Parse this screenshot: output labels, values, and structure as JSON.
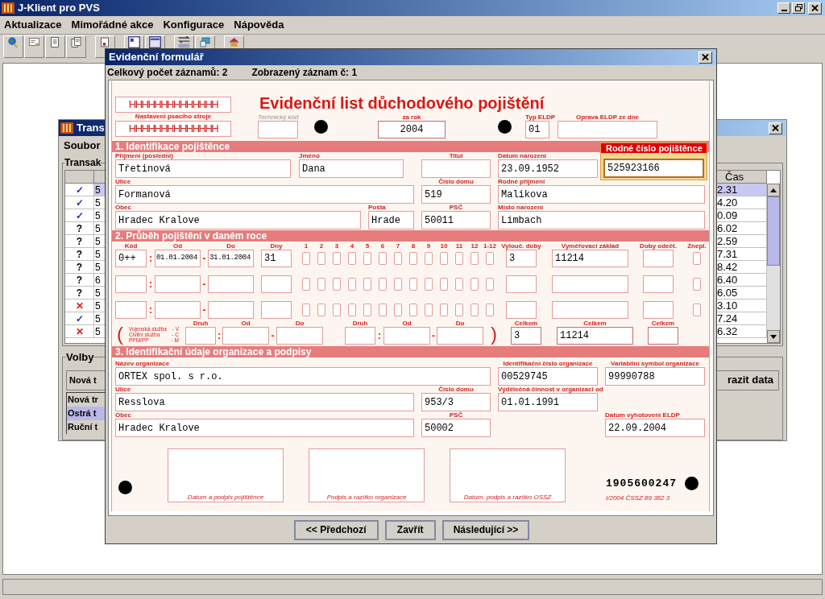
{
  "app": {
    "title": "J-Klient pro PVS",
    "menu": [
      "Aktualizace",
      "Mimořádné akce",
      "Konfigurace",
      "Nápověda"
    ]
  },
  "transactions_window": {
    "title": "Trans",
    "menu": [
      "Soubor"
    ],
    "table_group": "Transak",
    "time_header": "Čas",
    "rows": [
      {
        "kind": "ok",
        "mark": "✓",
        "column_2": "5",
        "time": "2.31",
        "selected": true
      },
      {
        "kind": "ok",
        "mark": "✓",
        "column_2": "5",
        "time": "4.20",
        "selected": false
      },
      {
        "kind": "ok",
        "mark": "✓",
        "column_2": "5",
        "time": "0.09",
        "selected": false
      },
      {
        "kind": "pending",
        "mark": "?",
        "column_2": "5",
        "time": "6.02",
        "selected": false
      },
      {
        "kind": "pending",
        "mark": "?",
        "column_2": "5",
        "time": "2.59",
        "selected": false
      },
      {
        "kind": "pending",
        "mark": "?",
        "column_2": "5",
        "time": "7.31",
        "selected": false
      },
      {
        "kind": "pending",
        "mark": "?",
        "column_2": "5",
        "time": "8.42",
        "selected": false
      },
      {
        "kind": "pending",
        "mark": "?",
        "column_2": "6",
        "time": "6.40",
        "selected": false
      },
      {
        "kind": "pending",
        "mark": "?",
        "column_2": "5",
        "time": "6.05",
        "selected": false
      },
      {
        "kind": "error",
        "mark": "✕",
        "column_2": "5",
        "time": "3.10",
        "selected": false
      },
      {
        "kind": "ok",
        "mark": "✓",
        "column_2": "5",
        "time": "7.24",
        "selected": false
      },
      {
        "kind": "error",
        "mark": "✕",
        "column_2": "5",
        "time": "6.32",
        "selected": false
      }
    ],
    "options_group": "Volby",
    "new_button": "Nová t",
    "modes": [
      {
        "label": "Nová tr",
        "selected": false
      },
      {
        "label": "Ostrá t",
        "selected": true
      },
      {
        "label": "Ruční t",
        "selected": false
      }
    ],
    "show_button": "razit data"
  },
  "dialog": {
    "title": "Evidenční formulář",
    "record_count": "Celkový počet záznamů: 2",
    "current_record": "Zobrazený záznam č: 1",
    "form": {
      "header": {
        "typewriter_label": "Nastavení psacího stroje",
        "typewriter_test": [
          "HHHHHHHHHHHHHH",
          "HHHHHHHHHHHHHH"
        ],
        "title": "Evidenční list důchodového pojištění",
        "technical_code": {
          "label": "Technický kód"
        },
        "year": {
          "label": "za rok",
          "value": "2004"
        },
        "eldp_type": {
          "label": "Typ ELDP",
          "value": "01"
        },
        "correction_date": {
          "label": "Oprava ELDP ze dne"
        }
      },
      "section_1": {
        "title": "1. Identifikace pojištěnce",
        "birth_number": {
          "label": "Rodné číslo pojištěnce",
          "value": "525923166"
        },
        "rows": [
          {
            "surname": {
              "label": "Příjmení (poslední)",
              "value": "Třetinová"
            },
            "first_name": {
              "label": "Jméno",
              "value": "Dana"
            },
            "degree": {
              "label": "Titul"
            },
            "birth_date": {
              "label": "Datum narození",
              "value": "23.09.1952"
            }
          },
          {
            "street": {
              "label": "Ulice",
              "value": "Formanová"
            },
            "house_number": {
              "label": "Číslo domu",
              "value": "519"
            },
            "birth_surname": {
              "label": "Rodné příjmení",
              "value": "Malikova"
            }
          },
          {
            "town": {
              "label": "Obec",
              "value": "Hradec Kralove"
            },
            "post_office": {
              "label": "Pošta",
              "value": "Hrade"
            },
            "postcode": {
              "label": "PSČ",
              "value": "50011"
            },
            "birth_place": {
              "label": "Místo narození",
              "value": "Limbach"
            }
          }
        ]
      },
      "section_2": {
        "title": "2. Průběh pojištění v daném roce",
        "headers": [
          "Kód",
          "Od",
          "Do",
          "Dny"
        ],
        "months": [
          "1",
          "2",
          "3",
          "4",
          "5",
          "6",
          "7",
          "8",
          "9",
          "10",
          "11",
          "12",
          "1-12"
        ],
        "right_headers": [
          "Vylouč. doby",
          "Vyměřovací základ",
          "Doby odečt.",
          "Znepl."
        ],
        "periods": [
          {
            "code": "0++",
            "sep_1": ":",
            "from": "01.01.2004",
            "sep_2": "-",
            "to": "31.01.2004",
            "days": "31",
            "excluded": "3",
            "base": "11214",
            "znepl": false,
            "checks": [
              {
                "checked": false
              },
              {
                "checked": false
              },
              {
                "checked": false
              },
              {
                "checked": false
              },
              {
                "checked": false
              },
              {
                "checked": false
              },
              {
                "checked": false
              },
              {
                "checked": false
              },
              {
                "checked": false
              },
              {
                "checked": false
              },
              {
                "checked": false
              },
              {
                "checked": false
              },
              {
                "checked": false
              }
            ]
          },
          {
            "sep_1": ":",
            "sep_2": "-",
            "znepl": false,
            "checks": [
              {
                "checked": false
              },
              {
                "checked": false
              },
              {
                "checked": false
              },
              {
                "checked": false
              },
              {
                "checked": false
              },
              {
                "checked": false
              },
              {
                "checked": false
              },
              {
                "checked": false
              },
              {
                "checked": false
              },
              {
                "checked": false
              },
              {
                "checked": false
              },
              {
                "checked": false
              },
              {
                "checked": false
              }
            ]
          },
          {
            "sep_1": ":",
            "sep_2": "-",
            "znepl": false,
            "checks": [
              {
                "checked": false
              },
              {
                "checked": false
              },
              {
                "checked": false
              },
              {
                "checked": false
              },
              {
                "checked": false
              },
              {
                "checked": false
              },
              {
                "checked": false
              },
              {
                "checked": false
              },
              {
                "checked": false
              },
              {
                "checked": false
              },
              {
                "checked": false
              },
              {
                "checked": false
              },
              {
                "checked": false
              }
            ]
          }
        ],
        "service": {
          "open": "(",
          "legend": [
            {
              "name": "Vojenská služba",
              "code": "- V"
            },
            {
              "name": "Civilní služba",
              "code": "- C"
            },
            {
              "name": "PPM/PP",
              "code": "- M"
            }
          ],
          "groups": [
            {
              "labels": [
                "Druh",
                "Od",
                "Do"
              ],
              "sep_1": ":",
              "sep_2": "-"
            },
            {
              "labels": [
                "Druh",
                "Od",
                "Do"
              ],
              "sep_1": ":",
              "sep_2": "-"
            }
          ],
          "close": ")",
          "totals": [
            {
              "label": "Celkem",
              "value": "3"
            },
            {
              "label": "Celkem",
              "value": "11214"
            },
            {
              "label": "Celkem"
            }
          ]
        }
      },
      "section_3": {
        "title": "3. Identifikační údaje organizace a podpisy",
        "rows": [
          {
            "organization_name": {
              "label": "Název organizace",
              "value": "ORTEX spol. s r.o."
            },
            "organization_id": {
              "label": "Identifikační číslo organizace",
              "value": "00529745"
            },
            "variable_symbol": {
              "label": "Variabilní symbol organizace",
              "value": "99990788"
            }
          },
          {
            "street": {
              "label": "Ulice",
              "value": "Resslova"
            },
            "house_number": {
              "label": "Číslo domu",
              "value": "953/3"
            },
            "employment_since": {
              "label": "Výdělečná činnost v organizaci od",
              "value": "01.01.1991"
            }
          },
          {
            "town": {
              "label": "Obec",
              "value": "Hradec Kralove"
            },
            "postcode": {
              "label": "PSČ",
              "value": "50002"
            },
            "issue_date": {
              "label": "Datum vyhotovení ELDP",
              "value": "22.09.2004"
            }
          }
        ],
        "signatures": [
          "Datum a podpis pojištěnce",
          "Podpis a razítko organizace",
          "Datum, podpis a razítko OSSZ"
        ],
        "form_number": "1905600247",
        "form_code": "I/2004 ČSSZ 89 382 3"
      }
    },
    "buttons": [
      "<< Předchozí",
      "Zavřít",
      "Následující >>"
    ]
  }
}
